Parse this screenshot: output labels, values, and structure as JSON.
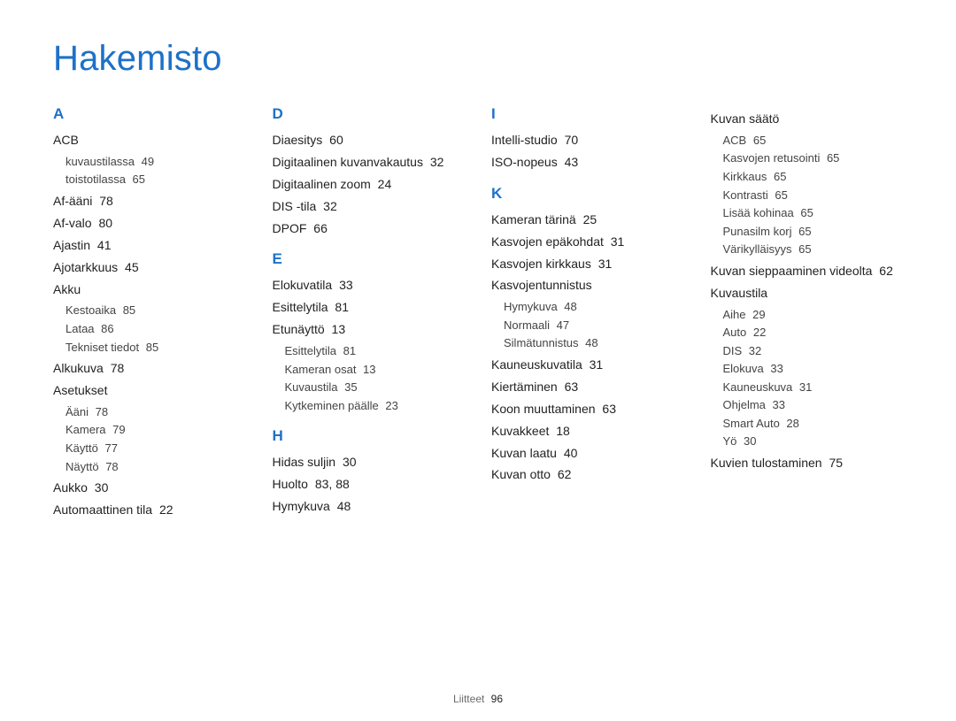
{
  "title": "Hakemisto",
  "footer": {
    "label": "Liitteet",
    "page": "96"
  },
  "columns": [
    {
      "groups": [
        {
          "letter": "A",
          "items": [
            {
              "term": "ACB",
              "sub": [
                {
                  "term": "kuvaustilassa",
                  "page": "49"
                },
                {
                  "term": "toistotilassa",
                  "page": "65"
                }
              ]
            },
            {
              "term": "Af-ääni",
              "page": "78"
            },
            {
              "term": "Af-valo",
              "page": "80"
            },
            {
              "term": "Ajastin",
              "page": "41"
            },
            {
              "term": "Ajotarkkuus",
              "page": "45"
            },
            {
              "term": "Akku",
              "sub": [
                {
                  "term": "Kestoaika",
                  "page": "85"
                },
                {
                  "term": "Lataa",
                  "page": "86"
                },
                {
                  "term": "Tekniset tiedot",
                  "page": "85"
                }
              ]
            },
            {
              "term": "Alkukuva",
              "page": "78"
            },
            {
              "term": "Asetukset",
              "sub": [
                {
                  "term": "Ääni",
                  "page": "78"
                },
                {
                  "term": "Kamera",
                  "page": "79"
                },
                {
                  "term": "Käyttö",
                  "page": "77"
                },
                {
                  "term": "Näyttö",
                  "page": "78"
                }
              ]
            },
            {
              "term": "Aukko",
              "page": "30"
            },
            {
              "term": "Automaattinen tila",
              "page": "22"
            }
          ]
        }
      ]
    },
    {
      "groups": [
        {
          "letter": "D",
          "items": [
            {
              "term": "Diaesitys",
              "page": "60"
            },
            {
              "term": "Digitaalinen kuvanvakautus",
              "page": "32"
            },
            {
              "term": "Digitaalinen zoom",
              "page": "24"
            },
            {
              "term": "DIS -tila",
              "page": "32"
            },
            {
              "term": "DPOF",
              "page": "66"
            }
          ]
        },
        {
          "letter": "E",
          "items": [
            {
              "term": "Elokuvatila",
              "page": "33"
            },
            {
              "term": "Esittelytila",
              "page": "81"
            },
            {
              "term": "Etunäyttö",
              "page": "13",
              "sub": [
                {
                  "term": "Esittelytila",
                  "page": "81"
                },
                {
                  "term": "Kameran osat",
                  "page": "13"
                },
                {
                  "term": "Kuvaustila",
                  "page": "35"
                },
                {
                  "term": "Kytkeminen päälle",
                  "page": "23"
                }
              ]
            }
          ]
        },
        {
          "letter": "H",
          "items": [
            {
              "term": "Hidas suljin",
              "page": "30"
            },
            {
              "term": "Huolto",
              "page": "83, 88"
            },
            {
              "term": "Hymykuva",
              "page": "48"
            }
          ]
        }
      ]
    },
    {
      "groups": [
        {
          "letter": "I",
          "items": [
            {
              "term": "Intelli-studio",
              "page": "70"
            },
            {
              "term": "ISO-nopeus",
              "page": "43"
            }
          ]
        },
        {
          "letter": "K",
          "items": [
            {
              "term": "Kameran tärinä",
              "page": "25"
            },
            {
              "term": "Kasvojen epäkohdat",
              "page": "31"
            },
            {
              "term": "Kasvojen kirkkaus",
              "page": "31"
            },
            {
              "term": "Kasvojentunnistus",
              "sub": [
                {
                  "term": "Hymykuva",
                  "page": "48"
                },
                {
                  "term": "Normaali",
                  "page": "47"
                },
                {
                  "term": "Silmätunnistus",
                  "page": "48"
                }
              ]
            },
            {
              "term": "Kauneuskuvatila",
              "page": "31"
            },
            {
              "term": "Kiertäminen",
              "page": "63"
            },
            {
              "term": "Koon muuttaminen",
              "page": "63"
            },
            {
              "term": "Kuvakkeet",
              "page": "18"
            },
            {
              "term": "Kuvan laatu",
              "page": "40"
            },
            {
              "term": "Kuvan otto",
              "page": "62"
            }
          ]
        }
      ]
    },
    {
      "groups": [
        {
          "items": [
            {
              "term": "Kuvan säätö",
              "sub": [
                {
                  "term": "ACB",
                  "page": "65"
                },
                {
                  "term": "Kasvojen retusointi",
                  "page": "65"
                },
                {
                  "term": "Kirkkaus",
                  "page": "65"
                },
                {
                  "term": "Kontrasti",
                  "page": "65"
                },
                {
                  "term": "Lisää kohinaa",
                  "page": "65"
                },
                {
                  "term": "Punasilm korj",
                  "page": "65"
                },
                {
                  "term": "Värikylläisyys",
                  "page": "65"
                }
              ]
            },
            {
              "term": "Kuvan sieppaaminen videolta",
              "page": "62"
            },
            {
              "term": "Kuvaustila",
              "sub": [
                {
                  "term": "Aihe",
                  "page": "29"
                },
                {
                  "term": "Auto",
                  "page": "22"
                },
                {
                  "term": "DIS",
                  "page": "32"
                },
                {
                  "term": "Elokuva",
                  "page": "33"
                },
                {
                  "term": "Kauneuskuva",
                  "page": "31"
                },
                {
                  "term": "Ohjelma",
                  "page": "33"
                },
                {
                  "term": "Smart Auto",
                  "page": "28"
                },
                {
                  "term": "Yö",
                  "page": "30"
                }
              ]
            },
            {
              "term": "Kuvien tulostaminen",
              "page": "75"
            }
          ]
        }
      ]
    }
  ]
}
